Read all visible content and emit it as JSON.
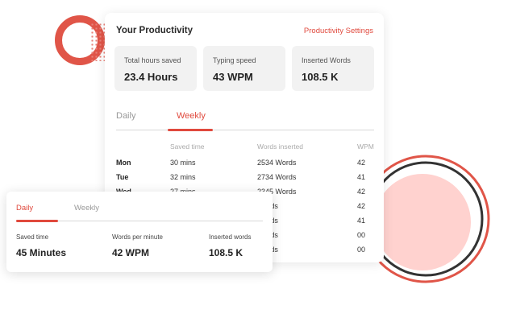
{
  "colors": {
    "accent": "#e0493d",
    "ring": "#e05548",
    "disc": "#ffd2cf",
    "dark_ring": "#333333"
  },
  "main": {
    "title": "Your Productivity",
    "settings_link": "Productivity Settings",
    "stats": [
      {
        "label": "Total hours saved",
        "value": "23.4 Hours"
      },
      {
        "label": "Typing speed",
        "value": "43 WPM"
      },
      {
        "label": "Inserted Words",
        "value": "108.5 K"
      }
    ],
    "tabs": [
      {
        "label": "Daily",
        "active": false
      },
      {
        "label": "Weekly",
        "active": true
      }
    ],
    "table": {
      "headers": [
        "",
        "Saved time",
        "Words inserted",
        "WPM"
      ],
      "rows": [
        {
          "day": "Mon",
          "time": "30 mins",
          "words": "2534 Words",
          "wpm": "42"
        },
        {
          "day": "Tue",
          "time": "32 mins",
          "words": "2734 Words",
          "wpm": "41"
        },
        {
          "day": "Wed",
          "time": "27 mins",
          "words": "2345 Words",
          "wpm": "42"
        },
        {
          "day": "",
          "time": "",
          "words": "Words",
          "wpm": "42"
        },
        {
          "day": "",
          "time": "",
          "words": "Words",
          "wpm": "41"
        },
        {
          "day": "",
          "time": "",
          "words": "Words",
          "wpm": "00"
        },
        {
          "day": "",
          "time": "",
          "words": "Words",
          "wpm": "00"
        }
      ]
    }
  },
  "overlay": {
    "tabs": [
      {
        "label": "Daily",
        "active": true
      },
      {
        "label": "Weekly",
        "active": false
      }
    ],
    "stats": [
      {
        "label": "Saved time",
        "value": "45 Minutes"
      },
      {
        "label": "Words per minute",
        "value": "42 WPM"
      },
      {
        "label": "Inserted words",
        "value": "108.5 K"
      }
    ]
  }
}
